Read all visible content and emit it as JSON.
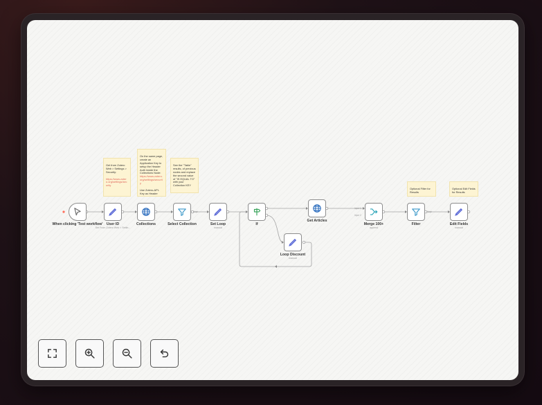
{
  "nodes": {
    "trigger": {
      "label": "When clicking 'Test workflow'",
      "icon": "mouse-pointer-icon"
    },
    "user_id": {
      "label": "User ID",
      "sub": "Set From Zotero Web > Settin...",
      "icon": "pencil-icon"
    },
    "collections": {
      "label": "Collections",
      "icon": "globe-icon"
    },
    "select_collection": {
      "label": "Select Collection",
      "icon": "filter-icon"
    },
    "set_loop": {
      "label": "Set Loop",
      "sub": "manual",
      "icon": "pencil-icon"
    },
    "if": {
      "label": "If",
      "icon": "signpost-icon"
    },
    "get_articles": {
      "label": "Get Articles",
      "icon": "globe-icon"
    },
    "merge": {
      "label": "Merge 100+",
      "sub": "append",
      "icon": "merge-icon",
      "input1": "Input 1",
      "input2": "Input 2"
    },
    "filter": {
      "label": "Filter",
      "icon": "filter-icon"
    },
    "edit_fields": {
      "label": "Edit Fields",
      "sub": "manual",
      "icon": "pencil-icon"
    },
    "loop_discount": {
      "label": "Loop Discount",
      "sub": "manual",
      "icon": "pencil-icon"
    }
  },
  "edges": {
    "kept_label_1": "Kept",
    "kept_label_2": "Kept"
  },
  "notes": {
    "zotero": {
      "text": "Get from Zotero Web > Settings > Security:",
      "link": "https://www.zotero.org/settings/security"
    },
    "api_key": {
      "text": "On the same page, create an Application Key to setup the Header Auth inside the Collections Node:",
      "link": "https://www.zotero.org/settings/security",
      "text2": "Use Zotero-API-Key as Header"
    },
    "table": {
      "text": "See the \"Table\" results, of previous nodes and replace the second value of \"IS EQUAL TO\" with your Collection KEY"
    },
    "filter": {
      "text": "Optional Filter for Results"
    },
    "edit": {
      "text": "Optional Edit Fields for Results"
    }
  },
  "controls": {
    "fit": "fit-view-icon",
    "zoom_in": "zoom-in-icon",
    "zoom_out": "zoom-out-icon",
    "undo": "undo-icon"
  },
  "colors": {
    "edge": "#a3a3a3",
    "sticky": "#fdf4d3",
    "link": "#e0665b",
    "pencil": "#5867d6",
    "globe": "#2f6fbf",
    "filter": "#3b98c9",
    "trigger": "#6b6b6b",
    "if": "#3aa45c",
    "merge": "#2aa4b8",
    "start_dot": "#ff6d5a"
  }
}
